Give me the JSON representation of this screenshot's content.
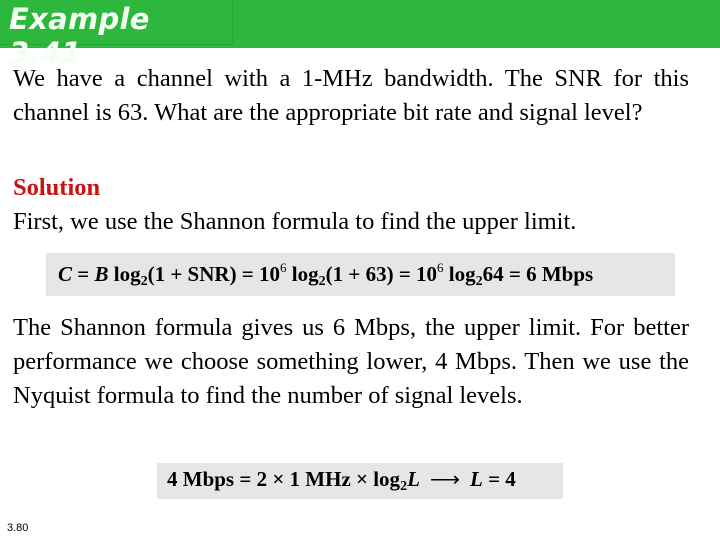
{
  "title": "Example 3.41",
  "question": "We have a channel with a 1-MHz bandwidth. The SNR for this channel is 63. What are the appropriate bit rate and signal level?",
  "solution_heading": "Solution",
  "solution_intro": "First, we use the Shannon formula to find the upper limit.",
  "formula1": {
    "lhs_C": "C",
    "eq1": " = ",
    "B": "B",
    "log": " log",
    "sub2": "2",
    "arg1": "(1 + SNR) = 10",
    "exp6a": "6",
    "log_b": " log",
    "sub2b": "2",
    "arg2": "(1 + 63) = 10",
    "exp6b": "6",
    "log_c": " log",
    "sub2c": "2",
    "arg3": "64 = 6 Mbps"
  },
  "explanation": "The Shannon formula gives us 6 Mbps, the upper limit. For better performance we choose something lower, 4 Mbps. Then we use the Nyquist formula to find the number of signal levels.",
  "formula2": {
    "lhs": "4 Mbps = 2 × 1 MHz × log",
    "sub2": "2",
    "L1": "L",
    "arrow": "⟶",
    "L2": "L",
    "rhs": " = 4"
  },
  "slide_number": "3.80"
}
